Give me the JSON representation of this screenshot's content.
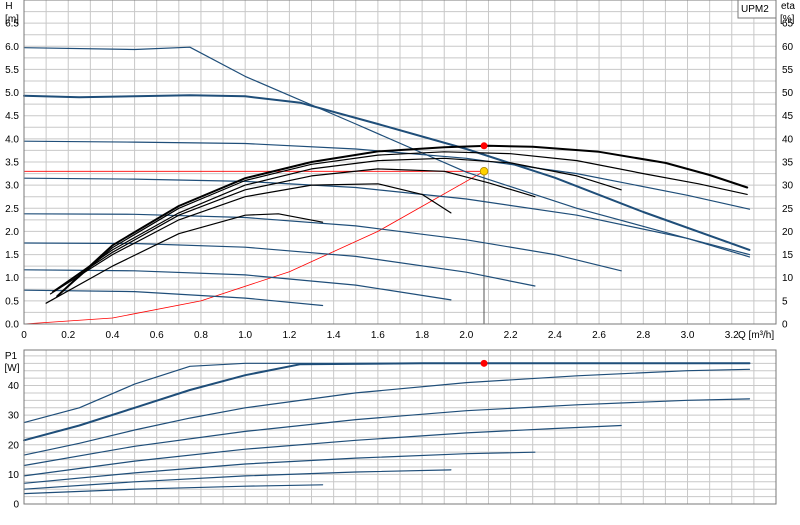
{
  "chart_data": [
    {
      "type": "line",
      "ylabel": "H",
      "yunit": "[m]",
      "y2label": "eta",
      "y2unit": "[%]",
      "xlabel": "Q [m³/h]",
      "legend": "UPM2",
      "xlim": [
        0,
        3.4
      ],
      "ylim": [
        0,
        7.0
      ],
      "y2lim": [
        0,
        70
      ],
      "x_ticks": [
        "0",
        "0.2",
        "0.4",
        "0.6",
        "0.8",
        "1.0",
        "1.2",
        "1.4",
        "1.6",
        "1.8",
        "2.0",
        "2.2",
        "2.4",
        "2.6",
        "2.8",
        "3.0",
        "3.2"
      ],
      "y_ticks": [
        "0.0",
        "0.5",
        "1.0",
        "1.5",
        "2.0",
        "2.5",
        "3.0",
        "3.5",
        "4.0",
        "4.5",
        "5.0",
        "5.5",
        "6.0",
        "6.5"
      ],
      "y2_ticks": [
        "0",
        "5",
        "10",
        "15",
        "20",
        "25",
        "30",
        "35",
        "40",
        "45",
        "50",
        "55",
        "60",
        "65"
      ],
      "grid": true,
      "head_curves": [
        {
          "x": [
            0,
            0.25,
            0.5,
            0.75,
            1.0,
            1.25,
            1.6,
            2.0,
            2.4,
            2.8,
            3.28
          ],
          "y": [
            4.93,
            4.9,
            4.92,
            4.94,
            4.92,
            4.78,
            4.32,
            3.78,
            3.16,
            2.42,
            1.6
          ]
        },
        {
          "x": [
            0,
            0.5,
            1.0,
            1.5,
            2.0,
            2.5,
            3.0,
            3.28
          ],
          "y": [
            3.95,
            3.93,
            3.9,
            3.78,
            3.58,
            3.25,
            2.78,
            2.48
          ]
        },
        {
          "x": [
            0,
            0.5,
            1.0,
            1.5,
            2.0,
            2.5,
            3.0,
            3.28
          ],
          "y": [
            3.15,
            3.13,
            3.08,
            2.95,
            2.7,
            2.35,
            1.85,
            1.45
          ]
        },
        {
          "x": [
            0,
            0.5,
            1.0,
            1.5,
            2.0,
            2.4,
            2.7
          ],
          "y": [
            2.38,
            2.37,
            2.3,
            2.12,
            1.82,
            1.5,
            1.15
          ]
        },
        {
          "x": [
            0,
            0.5,
            1.0,
            1.5,
            2.0,
            2.31
          ],
          "y": [
            1.75,
            1.74,
            1.66,
            1.46,
            1.12,
            0.82
          ]
        },
        {
          "x": [
            0,
            0.5,
            1.0,
            1.5,
            1.93
          ],
          "y": [
            1.17,
            1.15,
            1.06,
            0.84,
            0.52
          ]
        },
        {
          "x": [
            0,
            0.5,
            1.0,
            1.35
          ],
          "y": [
            0.73,
            0.7,
            0.56,
            0.4
          ]
        }
      ],
      "max_curve": {
        "x": [
          0,
          0.5,
          0.75,
          1.0,
          1.5,
          2.0,
          2.5,
          3.0,
          3.28
        ],
        "y": [
          5.97,
          5.93,
          5.98,
          5.35,
          4.32,
          3.28,
          2.5,
          1.85,
          1.5
        ]
      },
      "eta_curves": [
        {
          "x": [
            0.15,
            0.4,
            0.7,
            1.0,
            1.3,
            1.6,
            1.9,
            2.1,
            2.3,
            2.6,
            2.9,
            3.1,
            3.27
          ],
          "y": [
            6,
            17,
            25.5,
            31.5,
            35,
            37.3,
            38.2,
            38.5,
            38.3,
            37.2,
            34.8,
            32.2,
            29.5
          ]
        },
        {
          "x": [
            0.15,
            0.4,
            0.7,
            1.0,
            1.3,
            1.6,
            1.9,
            2.2,
            2.5,
            2.8,
            3.05,
            3.27
          ],
          "y": [
            6,
            16.5,
            25,
            31,
            34.5,
            36.5,
            37.2,
            36.8,
            35.3,
            32.5,
            30.3,
            28
          ]
        },
        {
          "x": [
            0.13,
            0.4,
            0.7,
            1.0,
            1.3,
            1.6,
            1.9,
            2.2,
            2.5,
            2.7
          ],
          "y": [
            7,
            16,
            24,
            30,
            33.5,
            35.3,
            35.8,
            34.8,
            32,
            29
          ]
        },
        {
          "x": [
            0.13,
            0.4,
            0.7,
            1.0,
            1.3,
            1.6,
            1.9,
            2.1,
            2.31
          ],
          "y": [
            7,
            15.5,
            23.5,
            29,
            32,
            33.5,
            33,
            30.5,
            27.5
          ]
        },
        {
          "x": [
            0.12,
            0.4,
            0.7,
            1.0,
            1.3,
            1.6,
            1.8,
            1.93
          ],
          "y": [
            6.5,
            15,
            22.5,
            27.5,
            30,
            30.3,
            28,
            24
          ]
        },
        {
          "x": [
            0.1,
            0.4,
            0.7,
            1.0,
            1.15,
            1.35
          ],
          "y": [
            4.5,
            12.5,
            19.5,
            23.5,
            23.8,
            22
          ]
        }
      ],
      "system_curve": {
        "x": [
          0,
          0.4,
          0.8,
          1.2,
          1.6,
          2.08
        ],
        "y": [
          0,
          0.13,
          0.5,
          1.13,
          2.0,
          3.3
        ]
      },
      "duty_line": {
        "x": [
          0,
          2.08
        ],
        "y": [
          3.3,
          3.3
        ]
      },
      "duty_drop": {
        "x": [
          2.08,
          2.08
        ],
        "y": [
          3.3,
          0
        ]
      },
      "duty_point": {
        "x": 2.08,
        "y": 3.3
      },
      "eta_max_point": {
        "x": 2.08,
        "y": 38.5
      },
      "colors": {
        "head": "#1f4e79",
        "eta": "#000000",
        "system": "#ff0000",
        "duty_point": "#ffd200",
        "max_point": "#ff0000",
        "grid": "#c8c8c8"
      }
    },
    {
      "type": "line",
      "ylabel": "P1",
      "yunit": "[W]",
      "xlim": [
        0,
        3.4
      ],
      "ylim": [
        0,
        52
      ],
      "y_ticks": [
        "0",
        "10",
        "20",
        "30",
        "40"
      ],
      "grid": true,
      "power_curves": [
        {
          "x": [
            0,
            0.25,
            0.5,
            0.75,
            1.0,
            1.25,
            1.8,
            2.3,
            2.8,
            3.28
          ],
          "y": [
            21.5,
            26.5,
            32.5,
            38.5,
            43.5,
            47.2,
            47.5,
            47.5,
            47.5,
            47.5
          ]
        },
        {
          "x": [
            0,
            0.25,
            0.5,
            0.75,
            1.0,
            1.5,
            2.0,
            2.5,
            3.0,
            3.28
          ],
          "y": [
            16.5,
            20.5,
            25,
            29,
            32.5,
            37.5,
            41,
            43.3,
            45,
            45.5
          ]
        },
        {
          "x": [
            0,
            0.5,
            1.0,
            1.5,
            2.0,
            2.5,
            3.0,
            3.28
          ],
          "y": [
            13,
            19.5,
            24.5,
            28.5,
            31.5,
            33.5,
            35,
            35.5
          ]
        },
        {
          "x": [
            0,
            0.5,
            1.0,
            1.5,
            2.0,
            2.4,
            2.7
          ],
          "y": [
            9.5,
            14.5,
            18.5,
            21.5,
            24,
            25.5,
            26.5
          ]
        },
        {
          "x": [
            0,
            0.5,
            1.0,
            1.5,
            2.0,
            2.31
          ],
          "y": [
            7,
            10.5,
            13.5,
            15.5,
            17,
            17.5
          ]
        },
        {
          "x": [
            0,
            0.5,
            1.0,
            1.5,
            1.93
          ],
          "y": [
            5,
            7.5,
            9.5,
            10.8,
            11.5
          ]
        },
        {
          "x": [
            0,
            0.5,
            1.0,
            1.35
          ],
          "y": [
            3.5,
            5,
            6,
            6.5
          ]
        }
      ],
      "max_power_curve": {
        "x": [
          0,
          0.25,
          0.5,
          0.75,
          1.0,
          1.5,
          2.0,
          2.5,
          3.0,
          3.28
        ],
        "y": [
          27.5,
          32.5,
          40.5,
          46.5,
          47.5,
          47.5,
          47.5,
          47.5,
          47.5,
          47.5
        ]
      },
      "duty_point": {
        "x": 2.08,
        "y": 47.5
      },
      "colors": {
        "power": "#1f4e79",
        "max_point": "#ff0000"
      }
    }
  ]
}
